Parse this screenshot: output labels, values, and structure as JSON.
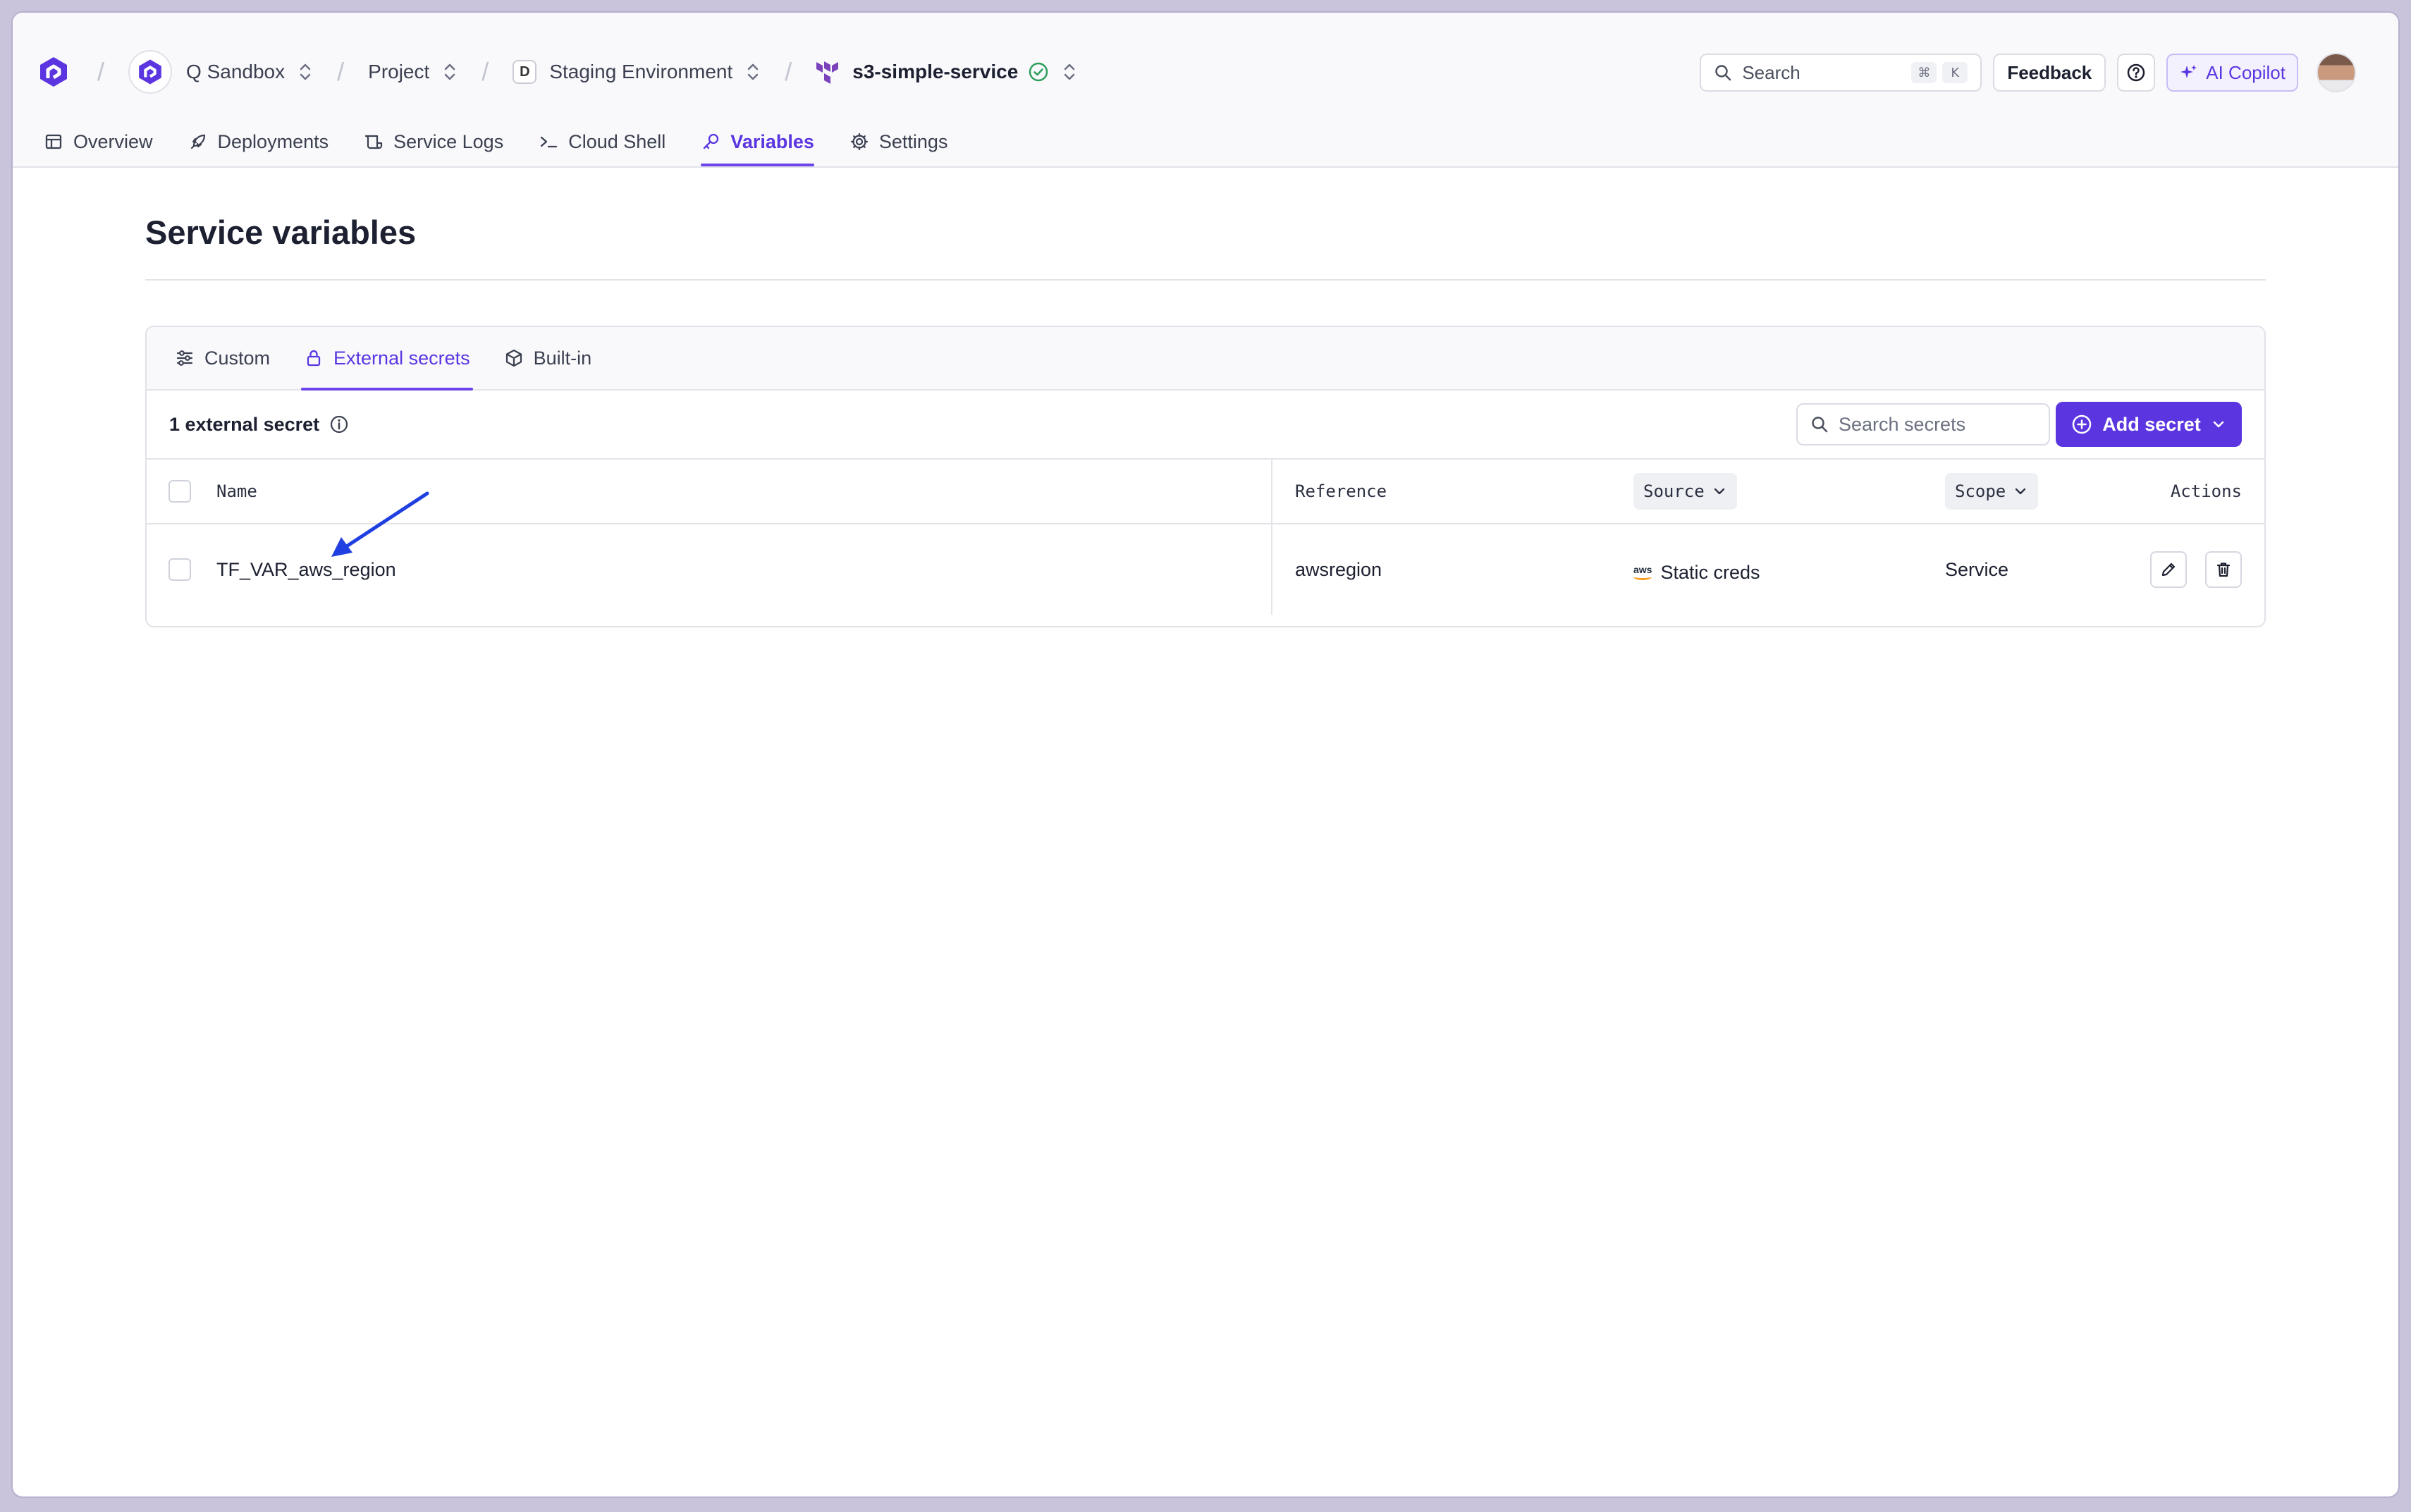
{
  "breadcrumbs": {
    "org": "Q Sandbox",
    "project": "Project",
    "environment_letter": "D",
    "environment": "Staging Environment",
    "service": "s3-simple-service"
  },
  "topbar": {
    "search_placeholder": "Search",
    "search_kbd_1": "⌘",
    "search_kbd_2": "K",
    "feedback": "Feedback",
    "copilot": "AI Copilot"
  },
  "nav_tabs": [
    {
      "label": "Overview"
    },
    {
      "label": "Deployments"
    },
    {
      "label": "Service Logs"
    },
    {
      "label": "Cloud Shell"
    },
    {
      "label": "Variables"
    },
    {
      "label": "Settings"
    }
  ],
  "page": {
    "title": "Service variables"
  },
  "variable_tabs": [
    {
      "label": "Custom"
    },
    {
      "label": "External secrets"
    },
    {
      "label": "Built-in"
    }
  ],
  "toolbar": {
    "count": "1 external secret",
    "search_placeholder": "Search secrets",
    "add_button": "Add secret"
  },
  "table": {
    "headers": {
      "name": "Name",
      "reference": "Reference",
      "source": "Source",
      "scope": "Scope",
      "actions": "Actions"
    },
    "rows": [
      {
        "name": "TF_VAR_aws_region",
        "reference": "awsregion",
        "source_logo": "aws",
        "source": "Static creds",
        "scope": "Service"
      }
    ]
  },
  "colors": {
    "accent": "#5b36e0",
    "annotation_arrow": "#1f3fe0",
    "success": "#2e9e5b"
  }
}
